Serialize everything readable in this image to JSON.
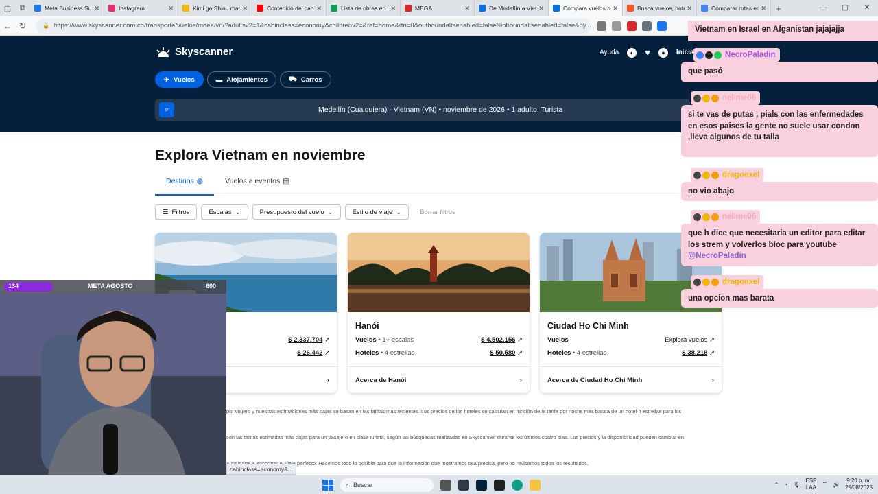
{
  "browser": {
    "tabs": [
      {
        "label": "Meta Business Suite",
        "color": "#1877f2"
      },
      {
        "label": "Instagram",
        "color": "#e1306c"
      },
      {
        "label": "Kimi ga Shinu made",
        "color": "#f4b400"
      },
      {
        "label": "Contenido del canal",
        "color": "#ff0000"
      },
      {
        "label": "Lista de obras en se",
        "color": "#0f9d58"
      },
      {
        "label": "MEGA",
        "color": "#d9272e"
      },
      {
        "label": "De Medellín a Vietn",
        "color": "#0770e3"
      },
      {
        "label": "Compara vuelos ba",
        "color": "#0770e3",
        "active": true
      },
      {
        "label": "Busca vuelos, hotel",
        "color": "#ff5722"
      },
      {
        "label": "Comparar rutas ec",
        "color": "#4285f4"
      }
    ],
    "url": "https://www.skyscanner.com.co/transporte/vuelos/mdea/vn/?adultsv2=1&cabinclass=economy&childrenv2=&ref=home&rtn=0&outboundaltsenabled=false&inboundaltsenabled=false&oy..."
  },
  "header": {
    "logo": "Skyscanner",
    "help": "Ayuda",
    "login": "Inicia",
    "tabs": [
      {
        "label": "Vuelos",
        "icon": "plane-icon",
        "active": true
      },
      {
        "label": "Alojamientos",
        "icon": "bed-icon"
      },
      {
        "label": "Carros",
        "icon": "car-icon"
      }
    ],
    "search_summary": "Medellín (Cualquiera) - Vietnam (VN)  •  noviembre de 2026  •  1 adulto, Turista"
  },
  "main": {
    "title": "Explora Vietnam en noviembre",
    "subtabs": [
      "Destinos",
      "Vuelos a eventos"
    ],
    "filters": [
      "Filtros",
      "Escalas",
      "Presupuesto del vuelo",
      "Estilo de viaje",
      "Borrar filtros"
    ],
    "cards": [
      {
        "name": "",
        "flight_label": "",
        "flight_sub": "",
        "flight_price": "$ 2.337.704",
        "hotel_label": "",
        "hotel_sub": "s",
        "hotel_price": "$ 26.442",
        "footer": "n"
      },
      {
        "name": "Hanói",
        "flight_label": "Vuelos",
        "flight_sub": " • 1+ escalas",
        "flight_price": "$ 4.502.156",
        "hotel_label": "Hoteles",
        "hotel_sub": " • 4 estrellas",
        "hotel_price": "$ 50.580",
        "footer": "Acerca de Hanói"
      },
      {
        "name": "Ciudad Ho Chi Minh",
        "flight_label": "Vuelos",
        "flight_sub": "",
        "flight_price": "Explora vuelos",
        "hotel_label": "Hoteles",
        "hotel_sub": " • 4 estrellas",
        "hotel_price": "$ 38.218",
        "footer": "Acerca de Ciudad Ho Chi Minh"
      }
    ],
    "disclaimers": [
      "por viajero y nuestras estimaciones más bajas se basan en las tarifas más recientes. Los precios de los hoteles se calculan en función de la tarifa por noche más barata de un hotel 4 estrellas para los",
      "son las tarifas estimadas más bajas para un pasajero en clase turista, según las búsquedas realizadas en Skyscanner durante los últimos cuatro días. Los precios y la disponibilidad pueden cambiar en",
      "a ayudarte a encontrar el viaje perfecto. Hacemos todo lo posible para que la información que mostramos sea precisa, pero no revisamos todos los resultados."
    ],
    "status_tip": "cabinclass=economy&..."
  },
  "chat": {
    "top_text": "Vietnam en Israel en Afganistan jajajajja",
    "messages": [
      {
        "user": "NecroPaladin",
        "user_color": "#a855f7",
        "text": "que pasó"
      },
      {
        "user": "nellme06",
        "user_color": "#f3a6c0",
        "text": "si te vas de putas , pials con las enfermedades en esos paises la gente no suele usar condon ,lleva algunos de tu talla"
      },
      {
        "user": "dragoexel",
        "user_color": "#f5b400",
        "text": "no vio abajo"
      },
      {
        "user": "nellme06",
        "user_color": "#f3a6c0",
        "text": "que h dice que necesitaria un editor para editar los strem y volverlos bloc para youtube"
      },
      {
        "user": "dragoexel",
        "user_color": "#f5b400",
        "text": "una opcion mas barata"
      }
    ],
    "mention": "@NecroPaladin"
  },
  "overlay": {
    "meta_count": "134",
    "meta_label": "META AGOSTO",
    "meta_goal": "600",
    "meta_progress": 0.223
  },
  "taskbar": {
    "search_placeholder": "Buscar",
    "lang_1": "ESP",
    "lang_2": "LAA",
    "time": "9:20 p. m.",
    "date": "25/08/2025"
  }
}
